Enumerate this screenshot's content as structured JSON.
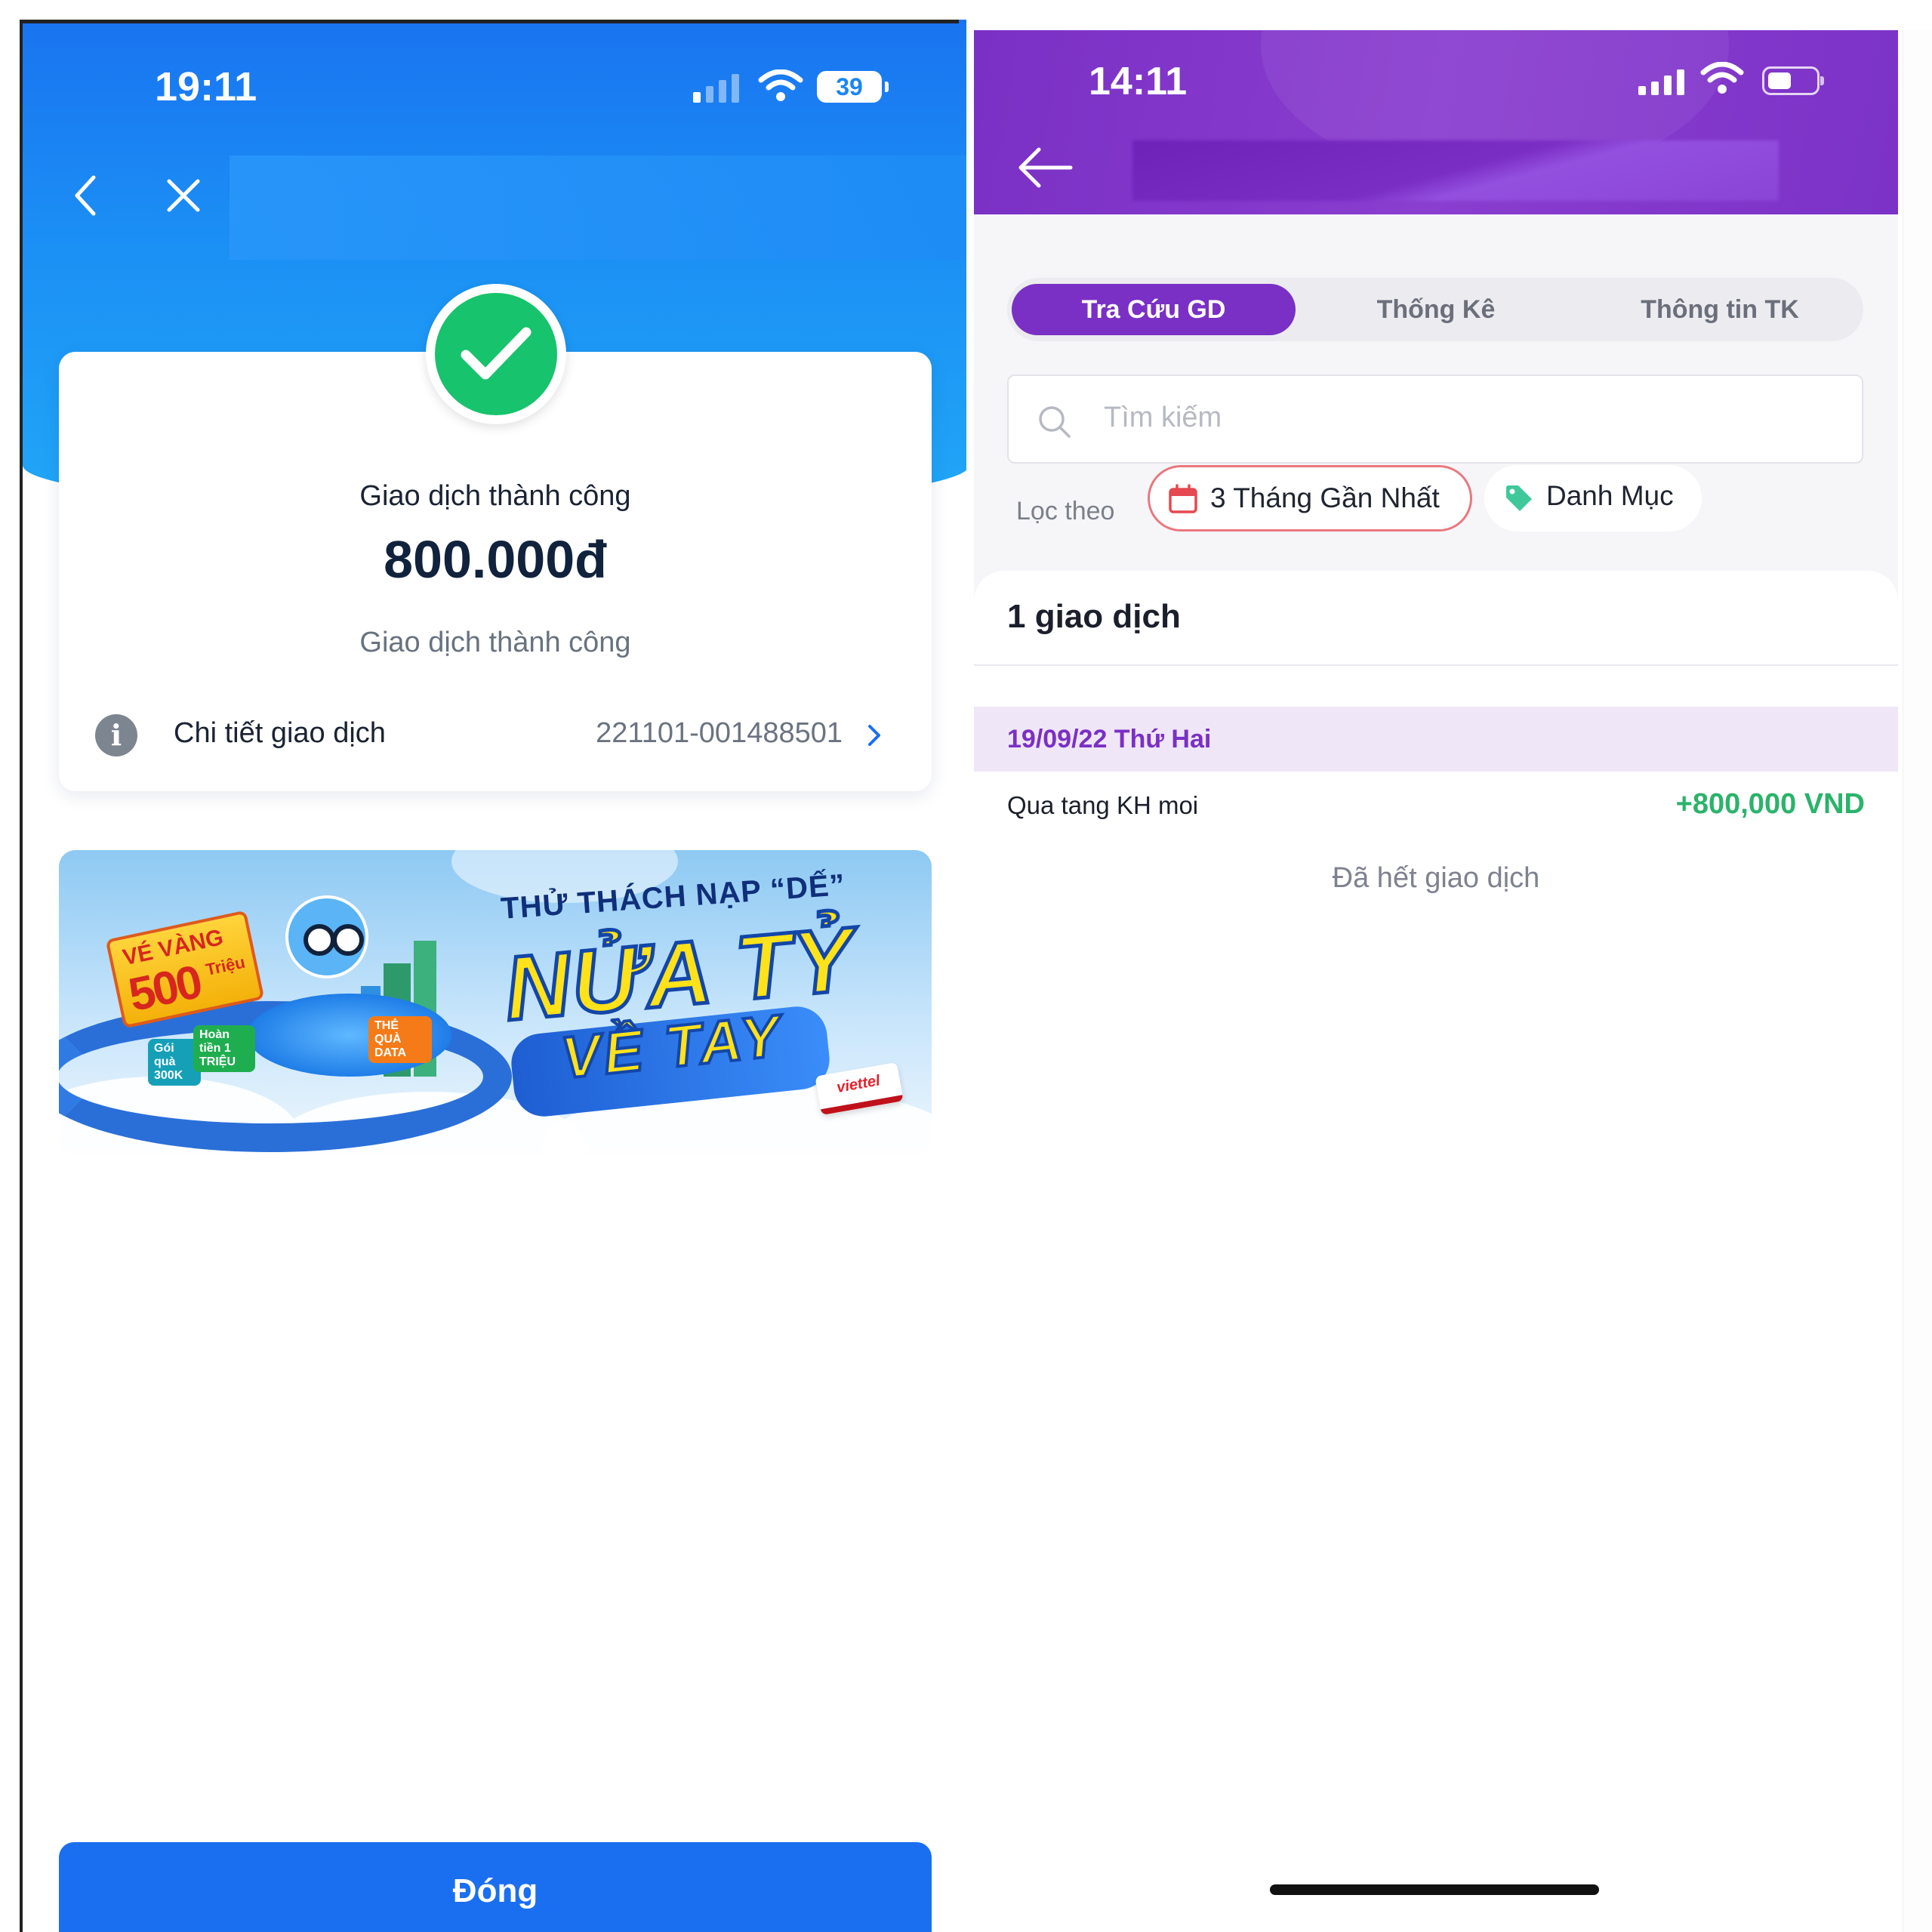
{
  "left_screen": {
    "status_time": "19:11",
    "battery_level": "39",
    "card": {
      "title": "Giao dịch thành công",
      "amount": "800.000đ",
      "subtitle": "Giao dịch thành công",
      "detail_label": "Chi tiết giao dịch",
      "detail_code": "221101-001488501"
    },
    "banner": {
      "ticket_top": "VÉ VÀNG",
      "ticket_number": "500",
      "ticket_unit": "Triệu",
      "tag_gift": "Gói quà 300K",
      "tag_refund": "Hoàn tiền 1 TRIỆU",
      "tag_data": "THẺ QUÀ DATA",
      "headline": "THỬ THÁCH NẠP “DẾ”",
      "big_line_1": "NỬA TỶ",
      "big_line_2": "VỀ TAY",
      "brand": "viettel"
    },
    "close_button": "Đóng"
  },
  "right_screen": {
    "status_time": "14:11",
    "tabs": [
      {
        "label": "Tra Cứu GD",
        "active": true
      },
      {
        "label": "Thống Kê",
        "active": false
      },
      {
        "label": "Thông tin TK",
        "active": false
      }
    ],
    "search_placeholder": "Tìm kiếm",
    "filter_label": "Lọc theo",
    "filter_date": "3 Tháng Gần Nhất",
    "filter_category": "Danh Mục",
    "transaction_count": "1 giao dịch",
    "date_group": "19/09/22 Thứ Hai",
    "transaction": {
      "name": "Qua tang KH moi",
      "amount": "+800,000 VND"
    },
    "end_message": "Đã hết giao dịch"
  },
  "colors": {
    "left_primary": "#1a6ff0",
    "success_green": "#17c36c",
    "right_primary": "#7a30c4",
    "amount_green": "#2bb36b",
    "chip_border": "#e9787f"
  },
  "icons": [
    "chevron-left-icon",
    "close-icon",
    "check-icon",
    "info-icon",
    "chevron-right-icon",
    "arrow-left-icon",
    "search-icon",
    "calendar-icon",
    "tag-icon",
    "wifi-icon",
    "signal-icon",
    "battery-icon"
  ]
}
